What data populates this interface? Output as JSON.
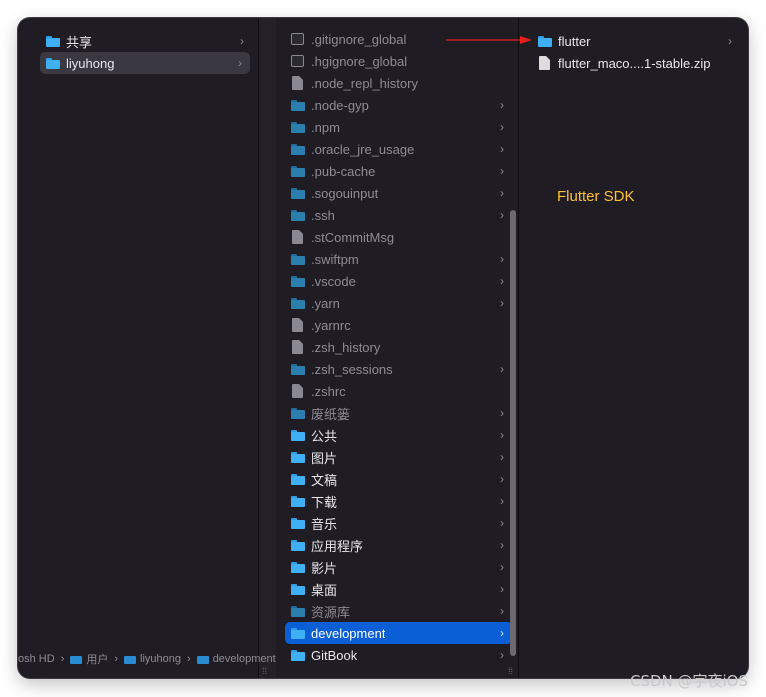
{
  "sidebar": {
    "items": [
      {
        "label": "共享",
        "icon": "folder-icon",
        "selected": false,
        "has_children": true
      },
      {
        "label": "liyuhong",
        "icon": "home-folder-icon",
        "selected": true,
        "has_children": true
      }
    ]
  },
  "column2": {
    "items": [
      {
        "label": ".gitignore_global",
        "icon": "terminal-file-icon",
        "dim": true,
        "chevron": false
      },
      {
        "label": ".hgignore_global",
        "icon": "terminal-file-icon",
        "dim": true,
        "chevron": false
      },
      {
        "label": ".node_repl_history",
        "icon": "document-icon",
        "dim": true,
        "chevron": false
      },
      {
        "label": ".node-gyp",
        "icon": "folder-icon",
        "dim": true,
        "chevron": true
      },
      {
        "label": ".npm",
        "icon": "folder-icon",
        "dim": true,
        "chevron": true
      },
      {
        "label": ".oracle_jre_usage",
        "icon": "folder-icon",
        "dim": true,
        "chevron": true
      },
      {
        "label": ".pub-cache",
        "icon": "folder-icon",
        "dim": true,
        "chevron": true
      },
      {
        "label": ".sogouinput",
        "icon": "folder-icon",
        "dim": true,
        "chevron": true
      },
      {
        "label": ".ssh",
        "icon": "folder-icon",
        "dim": true,
        "chevron": true
      },
      {
        "label": ".stCommitMsg",
        "icon": "document-icon",
        "dim": true,
        "chevron": false
      },
      {
        "label": ".swiftpm",
        "icon": "folder-icon",
        "dim": true,
        "chevron": true
      },
      {
        "label": ".vscode",
        "icon": "folder-icon",
        "dim": true,
        "chevron": true
      },
      {
        "label": ".yarn",
        "icon": "folder-icon",
        "dim": true,
        "chevron": true
      },
      {
        "label": ".yarnrc",
        "icon": "document-icon",
        "dim": true,
        "chevron": false
      },
      {
        "label": ".zsh_history",
        "icon": "document-icon",
        "dim": true,
        "chevron": false
      },
      {
        "label": ".zsh_sessions",
        "icon": "folder-icon",
        "dim": true,
        "chevron": true
      },
      {
        "label": ".zshrc",
        "icon": "document-icon",
        "dim": true,
        "chevron": false
      },
      {
        "label": "废纸篓",
        "icon": "folder-icon",
        "dim": true,
        "chevron": true
      },
      {
        "label": "公共",
        "icon": "folder-icon",
        "dim": false,
        "chevron": true
      },
      {
        "label": "图片",
        "icon": "folder-icon",
        "dim": false,
        "chevron": true
      },
      {
        "label": "文稿",
        "icon": "folder-icon",
        "dim": false,
        "chevron": true
      },
      {
        "label": "下载",
        "icon": "downloads-folder-icon",
        "dim": false,
        "chevron": true
      },
      {
        "label": "音乐",
        "icon": "music-folder-icon",
        "dim": false,
        "chevron": true
      },
      {
        "label": "应用程序",
        "icon": "applications-folder-icon",
        "dim": false,
        "chevron": true
      },
      {
        "label": "影片",
        "icon": "movies-folder-icon",
        "dim": false,
        "chevron": true
      },
      {
        "label": "桌面",
        "icon": "desktop-folder-icon",
        "dim": false,
        "chevron": true
      },
      {
        "label": "资源库",
        "icon": "folder-icon",
        "dim": true,
        "chevron": true
      },
      {
        "label": "development",
        "icon": "folder-icon",
        "dim": false,
        "chevron": true,
        "selected": true
      },
      {
        "label": "GitBook",
        "icon": "folder-icon",
        "dim": false,
        "chevron": true
      }
    ]
  },
  "column3": {
    "items": [
      {
        "label": "flutter",
        "icon": "folder-icon",
        "chevron": true
      },
      {
        "label": "flutter_maco....1-stable.zip",
        "icon": "zip-file-icon",
        "chevron": false
      }
    ],
    "annotation": "Flutter SDK"
  },
  "pathbar": {
    "items": [
      "osh HD",
      "用户",
      "liyuhong",
      "development"
    ]
  },
  "chevron_glyph": "›",
  "resize_glyph": "⁞⁞",
  "watermark": "CSDN @宇夜iOS",
  "colors": {
    "window_bg": "#1f1d23",
    "selection_blue": "#0b5fd6",
    "folder_blue": "#3fb0f3",
    "annotation_yellow": "#ffc22e",
    "arrow_red": "#e3201b"
  }
}
